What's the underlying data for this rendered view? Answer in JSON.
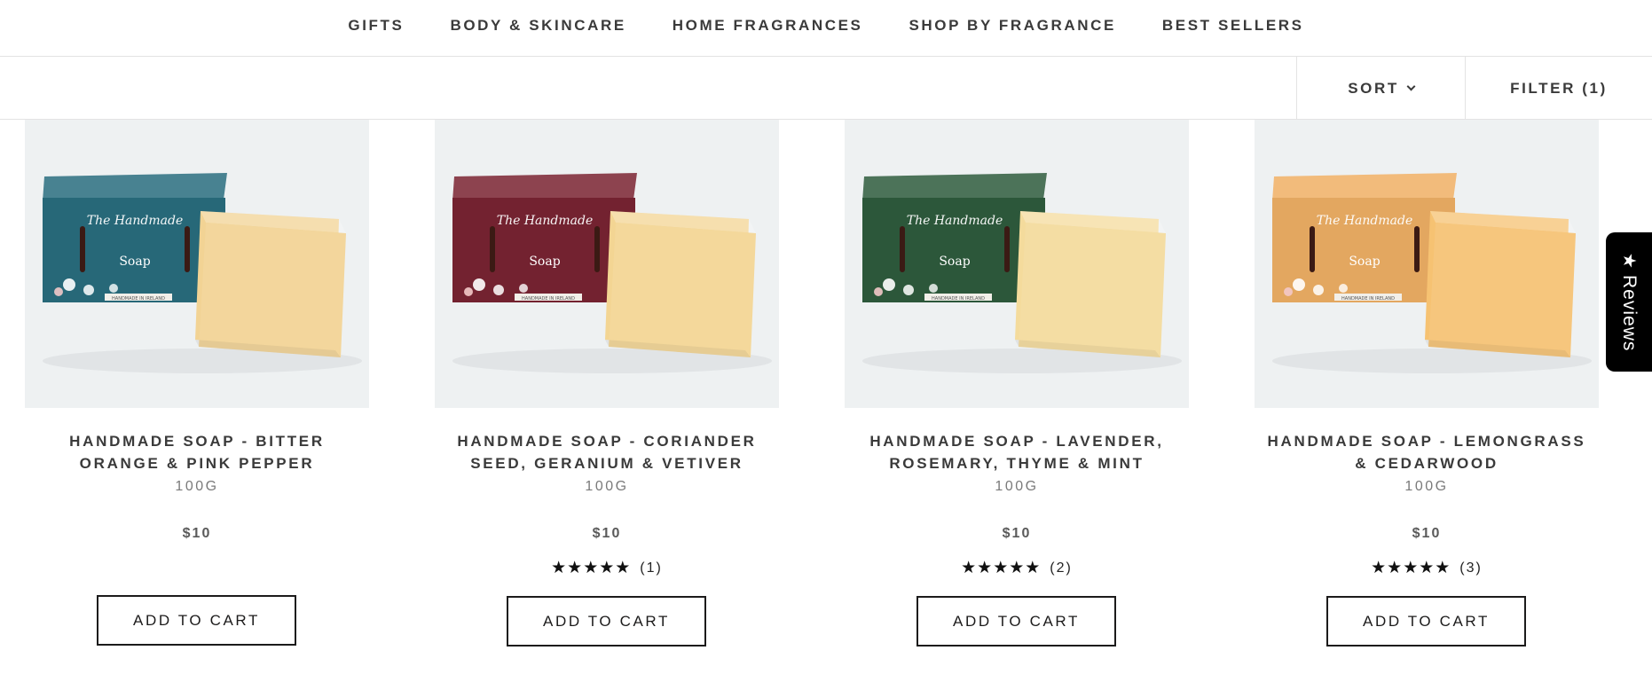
{
  "nav": {
    "items": [
      "GIFTS",
      "BODY & SKINCARE",
      "HOME FRAGRANCES",
      "SHOP BY FRAGRANCE",
      "BEST SELLERS"
    ]
  },
  "toolbar": {
    "sort_label": "SORT",
    "filter_label": "FILTER (1)"
  },
  "products": [
    {
      "title_line1": "HANDMADE SOAP - BITTER",
      "title_line2": "ORANGE & PINK PEPPER",
      "size": "100G",
      "price": "$10",
      "rating_count": "",
      "button": "ADD TO CART",
      "box_color": "#2a6f80",
      "soap_color": "#f2d394",
      "box_label": "Soap",
      "box_footer": "HANDMADE IN IRELAND"
    },
    {
      "title_line1": "HANDMADE SOAP - CORIANDER",
      "title_line2": "SEED, GERANIUM & VETIVER",
      "size": "100G",
      "price": "$10",
      "rating_count": "(1)",
      "button": "ADD TO CART",
      "box_color": "#7b2533",
      "soap_color": "#f3d593",
      "box_label": "Soap",
      "box_footer": "HANDMADE IN IRELAND"
    },
    {
      "title_line1": "HANDMADE SOAP - LAVENDER,",
      "title_line2": "ROSEMARY, THYME & MINT",
      "size": "100G",
      "price": "$10",
      "rating_count": "(2)",
      "button": "ADD TO CART",
      "box_color": "#2f5d3e",
      "soap_color": "#f4db9c",
      "box_label": "Soap",
      "box_footer": "HANDMADE IN IRELAND"
    },
    {
      "title_line1": "HANDMADE SOAP - LEMONGRASS",
      "title_line2": "& CEDARWOOD",
      "size": "100G",
      "price": "$10",
      "rating_count": "(3)",
      "button": "ADD TO CART",
      "box_color": "#f2b266",
      "soap_color": "#f6c272",
      "box_label": "Soap",
      "box_footer": "HANDMADE IN IRELAND"
    }
  ],
  "rating_stars": "★★★★★",
  "reviews_tab": {
    "icon": "star-icon",
    "label": "Reviews",
    "star_glyph": "★"
  }
}
